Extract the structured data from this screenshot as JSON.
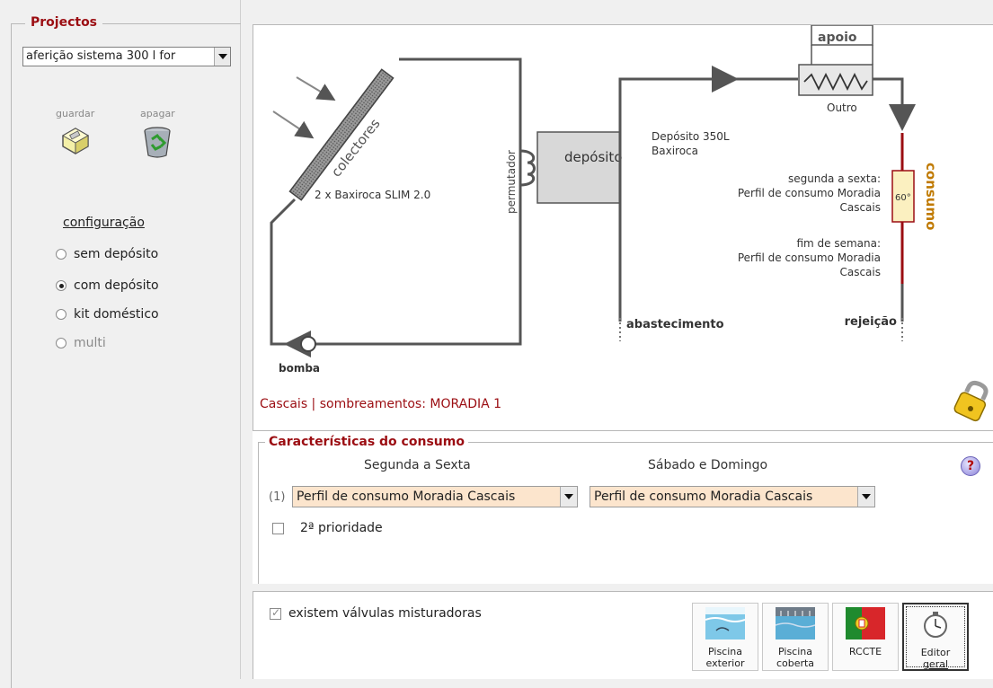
{
  "left": {
    "legend": "Projectos",
    "project_value": "aferição sistema 300 l for",
    "save_label": "guardar",
    "delete_label": "apagar",
    "config_title": "configuração",
    "config_options": [
      {
        "label": "sem depósito",
        "checked": false,
        "disabled": false
      },
      {
        "label": "com depósito",
        "checked": true,
        "disabled": false
      },
      {
        "label": "kit doméstico",
        "checked": false,
        "disabled": false
      },
      {
        "label": "multi",
        "checked": false,
        "disabled": true
      }
    ]
  },
  "diagram": {
    "collectors_label": "colectores",
    "collectors_model": "2 x Baxiroca SLIM 2.0",
    "exchanger_label": "permutador",
    "tank_label": "depósito",
    "tank_model_line1": "Depósito 350L",
    "tank_model_line2": "Baxiroca",
    "backup_label": "apoio",
    "backup_type": "Outro",
    "consumption_label": "consumo",
    "temp_label": "60°",
    "weekday_title": "segunda a sexta:",
    "weekday_profile_1": "Perfil de consumo Moradia",
    "weekday_profile_2": "Cascais",
    "weekend_title": "fim de semana:",
    "weekend_profile_1": "Perfil de consumo Moradia",
    "weekend_profile_2": "Cascais",
    "supply_label": "abastecimento",
    "rejection_label": "rejeição",
    "pump_label": "bomba",
    "location_text": "Cascais  |  sombreamentos: MORADIA 1"
  },
  "consumo": {
    "title": "Características do consumo",
    "weekday_header": "Segunda a Sexta",
    "weekend_header": "Sábado e Domingo",
    "row_index": "(1)",
    "weekday_profile": "Perfil de consumo Moradia Cascais",
    "weekend_profile": "Perfil de consumo Moradia Cascais",
    "second_priority_label": "2ª prioridade",
    "help": "?"
  },
  "bottom": {
    "mixing_valves_label": "existem válvulas misturadoras",
    "tiles": [
      {
        "line1": "Piscina",
        "line2": "exterior"
      },
      {
        "line1": "Piscina",
        "line2": "coberta"
      },
      {
        "line1": "",
        "line2": "RCCTE"
      },
      {
        "line1": "Editor",
        "line2": "geral"
      }
    ]
  },
  "colors": {
    "accent": "#9b0d12",
    "consumo_orange": "#c07a00",
    "select_bg": "#fce5cd"
  }
}
